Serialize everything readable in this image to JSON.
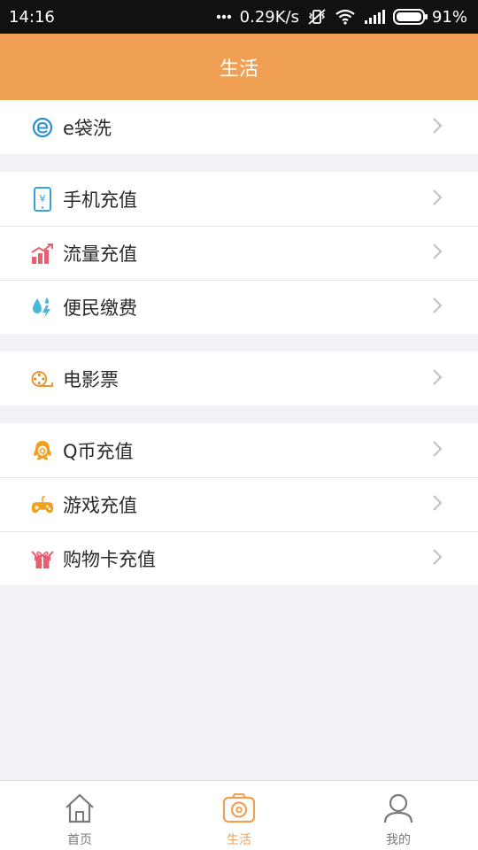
{
  "status": {
    "time": "14:16",
    "speed": "0.29K/s",
    "battery": "91%"
  },
  "header": {
    "title": "生活"
  },
  "groups": [
    {
      "items": [
        {
          "label": "e袋洗",
          "icon": "e-laundry-icon"
        }
      ]
    },
    {
      "items": [
        {
          "label": "手机充值",
          "icon": "phone-recharge-icon"
        },
        {
          "label": "流量充值",
          "icon": "data-recharge-icon"
        },
        {
          "label": "便民缴费",
          "icon": "utility-payment-icon"
        }
      ]
    },
    {
      "items": [
        {
          "label": "电影票",
          "icon": "film-ticket-icon"
        }
      ]
    },
    {
      "items": [
        {
          "label": "Q币充值",
          "icon": "qq-coin-icon"
        },
        {
          "label": "游戏充值",
          "icon": "gamepad-icon"
        },
        {
          "label": "购物卡充值",
          "icon": "gift-card-icon"
        }
      ]
    }
  ],
  "tabs": [
    {
      "label": "首页",
      "icon": "home-icon"
    },
    {
      "label": "生活",
      "icon": "camera-icon",
      "active": true
    },
    {
      "label": "我的",
      "icon": "profile-icon"
    }
  ],
  "colors": {
    "accent": "#f0a055",
    "background": "#f2f2f6"
  }
}
